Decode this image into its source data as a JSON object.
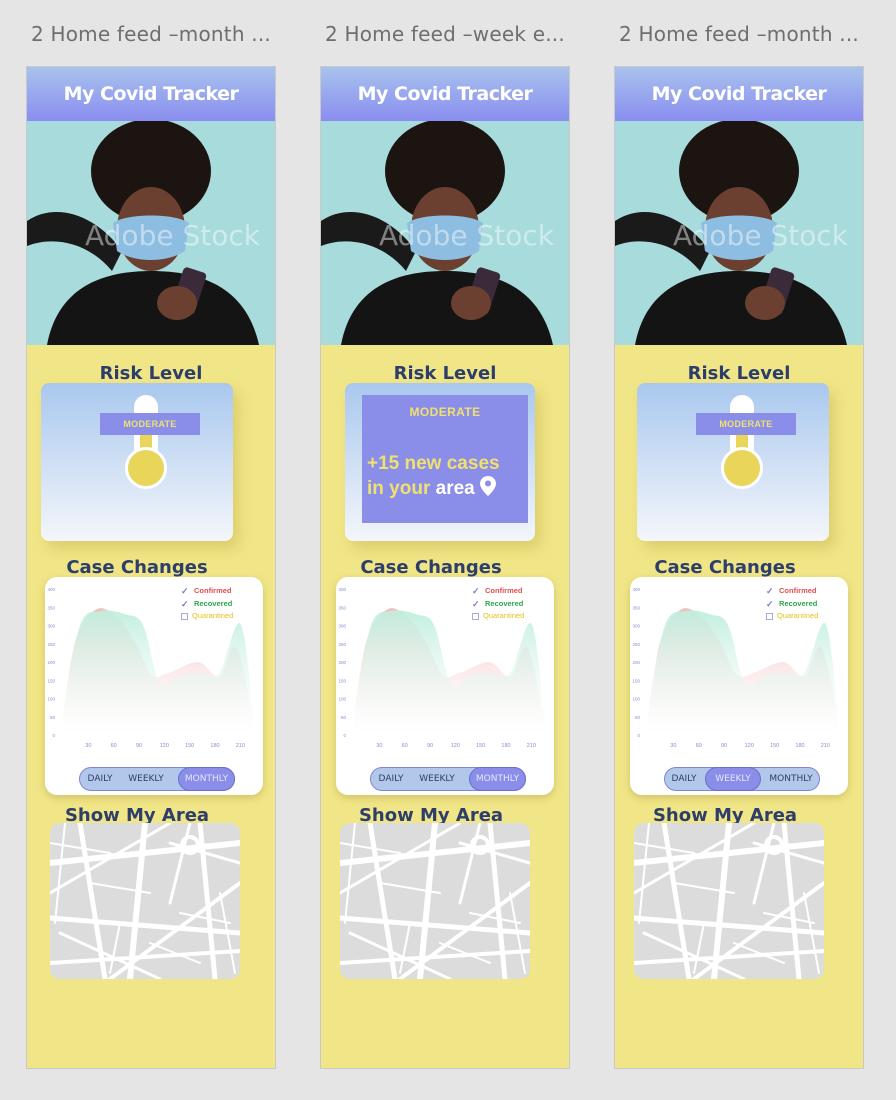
{
  "artboards": [
    {
      "title": "2 Home feed –month ..."
    },
    {
      "title": "2 Home feed –week e..."
    },
    {
      "title": "2 Home feed –month ..."
    }
  ],
  "app": {
    "header_title": "My Covid Tracker",
    "watermark": "Adobe Stock",
    "risk_title": "Risk Level",
    "risk_level": "MODERATE",
    "alert": {
      "highlight_1": "+15 new cases",
      "highlight_2": "in your",
      "plain": "area"
    },
    "case_title": "Case Changes",
    "legend": [
      "Confirmed",
      "Recovered",
      "Quarantined"
    ],
    "tabs": [
      "DAILY",
      "WEEKLY",
      "MONTHLY"
    ],
    "map_title": "Show My Area"
  },
  "colors": {
    "background": "#f1e687",
    "header": "#8a8ef0",
    "accent": "#8a8ee8",
    "confirmed": "#e05050",
    "recovered": "#2aa84a",
    "quarantined": "#e2c21a",
    "title": "#2d3e6b"
  },
  "chart_data": {
    "type": "area",
    "x": [
      30,
      60,
      90,
      120,
      150,
      180,
      210
    ],
    "y_ticks": [
      0,
      50,
      100,
      150,
      200,
      250,
      300,
      350,
      400
    ],
    "ylim": [
      0,
      400
    ],
    "xlim": [
      0,
      225
    ],
    "xlabel": "",
    "ylabel": "",
    "series": [
      {
        "name": "Confirmed",
        "color": "#f4b8b8",
        "points": [
          [
            0,
            50
          ],
          [
            15,
            260
          ],
          [
            40,
            345
          ],
          [
            65,
            320
          ],
          [
            85,
            255
          ],
          [
            105,
            165
          ],
          [
            125,
            170
          ],
          [
            160,
            200
          ],
          [
            185,
            160
          ],
          [
            205,
            240
          ],
          [
            225,
            50
          ]
        ]
      },
      {
        "name": "Recovered",
        "color": "#bfeedd",
        "points": [
          [
            0,
            60
          ],
          [
            20,
            300
          ],
          [
            45,
            340
          ],
          [
            75,
            330
          ],
          [
            95,
            300
          ],
          [
            115,
            140
          ],
          [
            140,
            165
          ],
          [
            165,
            170
          ],
          [
            185,
            170
          ],
          [
            210,
            305
          ],
          [
            225,
            60
          ]
        ]
      }
    ],
    "legend_position": "top-right",
    "selected_tab_by_artboard": [
      "MONTHLY",
      "MONTHLY",
      "WEEKLY"
    ]
  },
  "views": [
    {
      "risk_view": "thermometer"
    },
    {
      "risk_view": "alert"
    },
    {
      "risk_view": "thermometer"
    }
  ]
}
